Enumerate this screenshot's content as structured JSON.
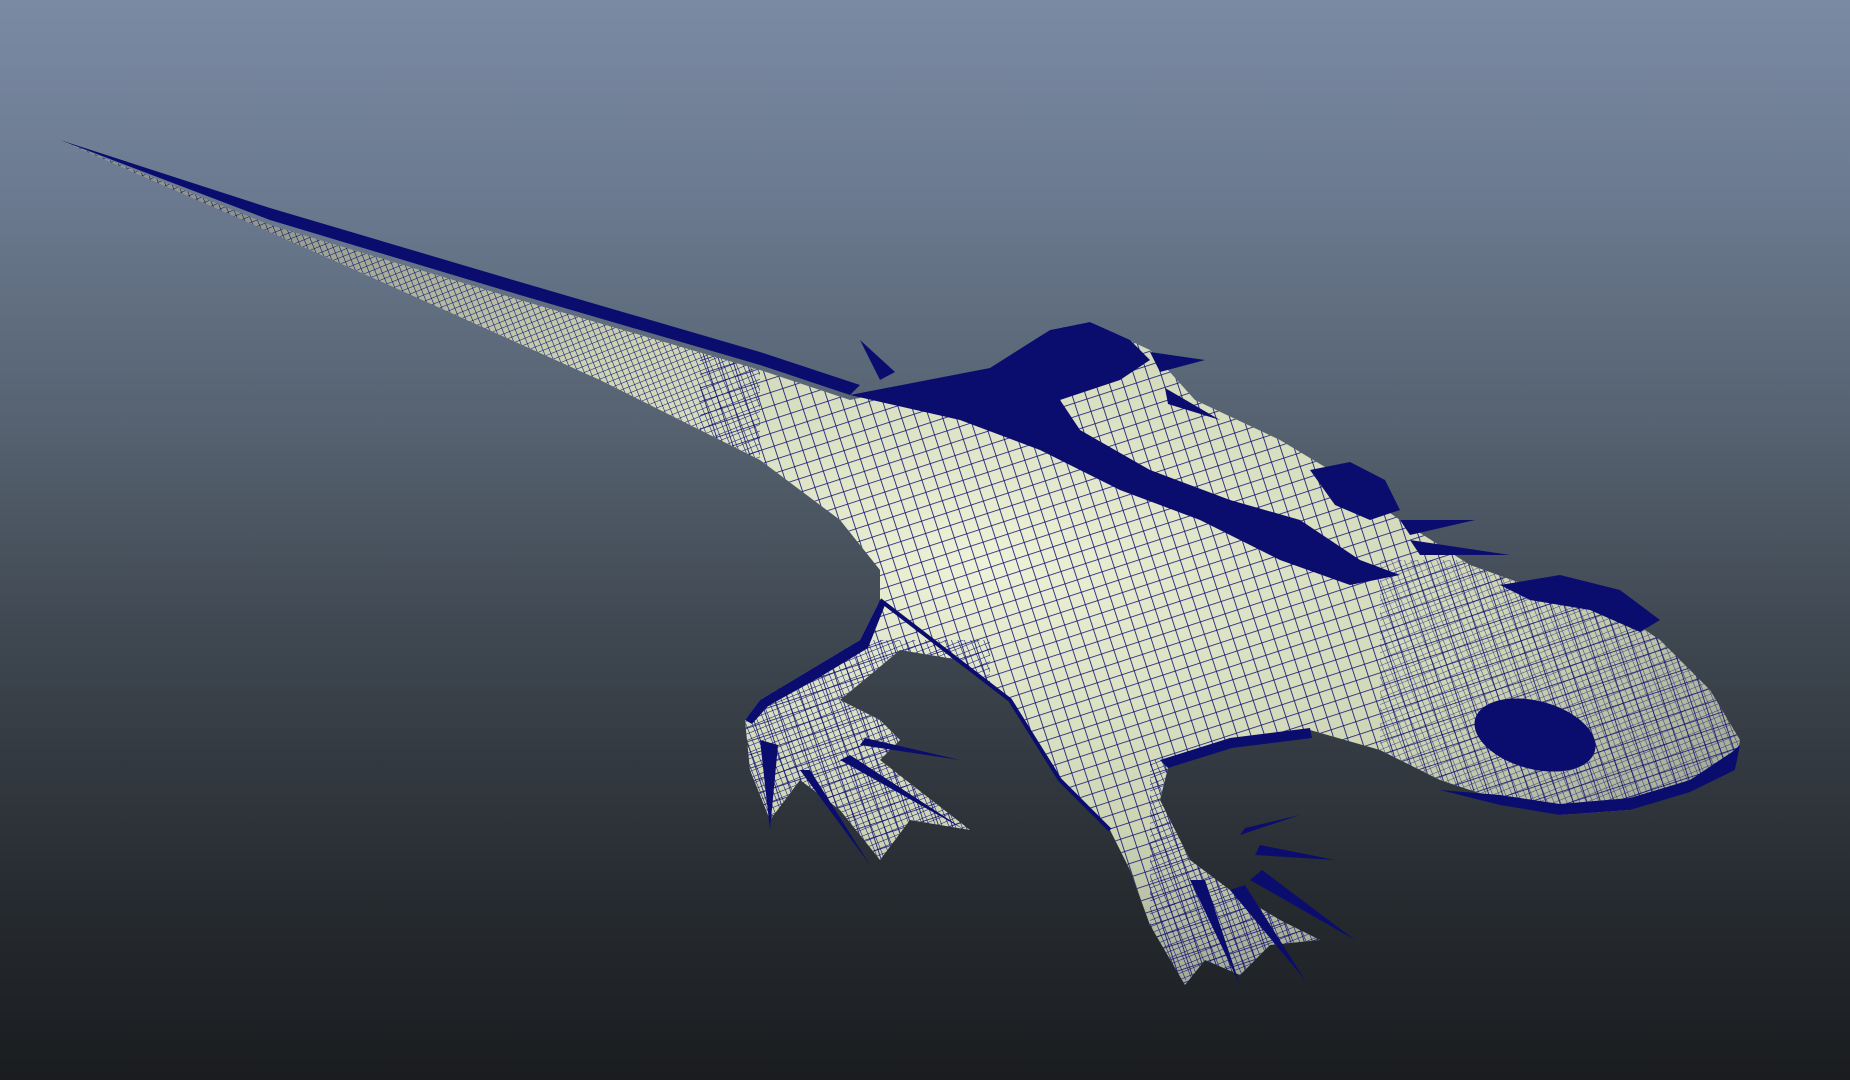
{
  "viewport": {
    "background_top": "#7b8aa3",
    "background_bottom": "#1a1c1f"
  },
  "model": {
    "display_mode": "wireframe-on-shaded",
    "wire_color": "#0b0d6e",
    "shade_color": "#e6ecd0",
    "subject": "lizard-mesh"
  }
}
